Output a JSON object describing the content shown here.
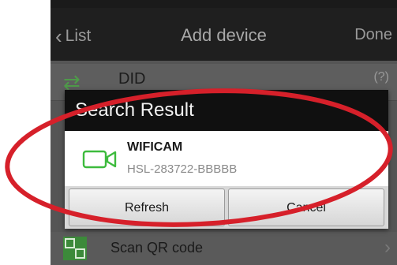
{
  "navbar": {
    "back_label": "List",
    "title": "Add device",
    "done_label": "Done"
  },
  "form": {
    "did_label": "DID",
    "did_help": "(?)",
    "scan_qr_label": "Scan QR code"
  },
  "dialog": {
    "title": "Search Result",
    "results": [
      {
        "name": "WIFICAM",
        "uid": "HSL-283722-BBBBB"
      }
    ],
    "refresh_label": "Refresh",
    "cancel_label": "Cancel"
  },
  "colors": {
    "camera_icon": "#3dbb3d",
    "annotation_circle": "#d6202a"
  },
  "icons": {
    "back": "chevron-left-icon",
    "camera": "video-camera-icon",
    "qr": "qr-code-icon",
    "forward": "chevron-right-icon"
  }
}
